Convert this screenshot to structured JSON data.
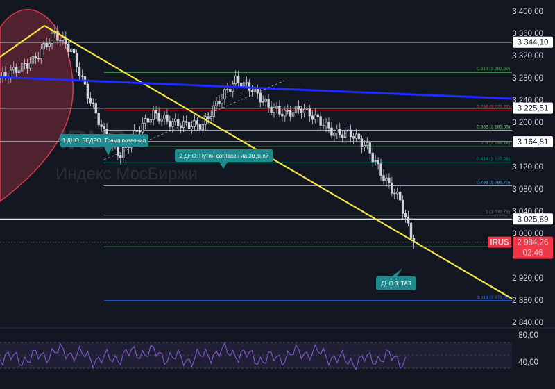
{
  "chart_data": {
    "type": "candlestick",
    "ticker_watermark": "IRUS",
    "instrument_name": "Индекс МосБиржи",
    "price_axis": {
      "ticks": [
        "3 400,00",
        "3 360,00",
        "3 320,00",
        "3 280,00",
        "3 240,00",
        "3 200,00",
        "3 160,00",
        "3 120,00",
        "3 080,00",
        "3 040,00",
        "3 000,00",
        "2 920,00",
        "2 880,00",
        "2 840,00"
      ],
      "range": [
        2830,
        3418
      ]
    },
    "rsi_axis": {
      "ticks": [
        "80,00",
        "40,00"
      ]
    },
    "current_price": {
      "symbol": "IRUS",
      "value": "2 984,26",
      "countdown": "02:46",
      "color": "#f23645"
    },
    "level_tags": [
      {
        "value": 3344.1,
        "text": "3 344,10"
      },
      {
        "value": 3225.51,
        "text": "3 225,51"
      },
      {
        "value": 3164.81,
        "text": "3 164,81"
      },
      {
        "value": 3025.89,
        "text": "3 025,89"
      }
    ],
    "fibonacci_levels": [
      {
        "label": "0.618 (3 289,69)",
        "color": "#4caf50",
        "value": 3289.69
      },
      {
        "label": "0.236 (3 221,77)",
        "color": "#f23645",
        "value": 3221.77
      },
      {
        "label": "0.382 (3 185,65)",
        "color": "#81c784",
        "value": 3185.65
      },
      {
        "label": "0.5 (3 156,16)",
        "color": "#4caf50",
        "value": 3156.16
      },
      {
        "label": "0.618 (3 127,26)",
        "color": "#089981",
        "value": 3127.26
      },
      {
        "label": "0.786 (3 085,70)",
        "color": "#64b5f6",
        "value": 3085.7
      },
      {
        "label": "1 (3 032,75)",
        "color": "#787b86",
        "value": 3032.75
      },
      {
        "label": "0.5 (",
        "color": "#4caf50",
        "value": 2976.0
      },
      {
        "label": "1.618 (2 879,00)",
        "color": "#2962ff",
        "value": 2879.0
      }
    ],
    "annotations": [
      "1 ДНО: БЕДРО. Трамп позвонил",
      "2 ДНО: Путин согласен на 30 дней",
      "ДНО 3: ТАЗ"
    ],
    "series": [
      {
        "name": "IRUS",
        "close_points": [
          [
            0,
            3280
          ],
          [
            6,
            3295
          ],
          [
            12,
            3310
          ],
          [
            20,
            3360
          ],
          [
            26,
            3330
          ],
          [
            32,
            3250
          ],
          [
            38,
            3180
          ],
          [
            44,
            3140
          ],
          [
            50,
            3185
          ],
          [
            56,
            3215
          ],
          [
            62,
            3200
          ],
          [
            68,
            3195
          ],
          [
            74,
            3195
          ],
          [
            80,
            3240
          ],
          [
            86,
            3275
          ],
          [
            92,
            3260
          ],
          [
            98,
            3228
          ],
          [
            104,
            3215
          ],
          [
            110,
            3225
          ],
          [
            116,
            3205
          ],
          [
            122,
            3180
          ],
          [
            128,
            3180
          ],
          [
            134,
            3155
          ],
          [
            140,
            3100
          ],
          [
            146,
            3060
          ],
          [
            150,
            2995
          ],
          [
            152,
            2984
          ]
        ]
      }
    ]
  },
  "colors": {
    "background": "#131722",
    "up_candle": "#ffffff",
    "down_candle": "#ffffff",
    "yellow_trend": "#f5e542",
    "blue_trend": "#1f2bff",
    "curve": "#d43a4b",
    "annotation_bg": "#1e8a8e",
    "rsi_line": "#7e57c2"
  }
}
